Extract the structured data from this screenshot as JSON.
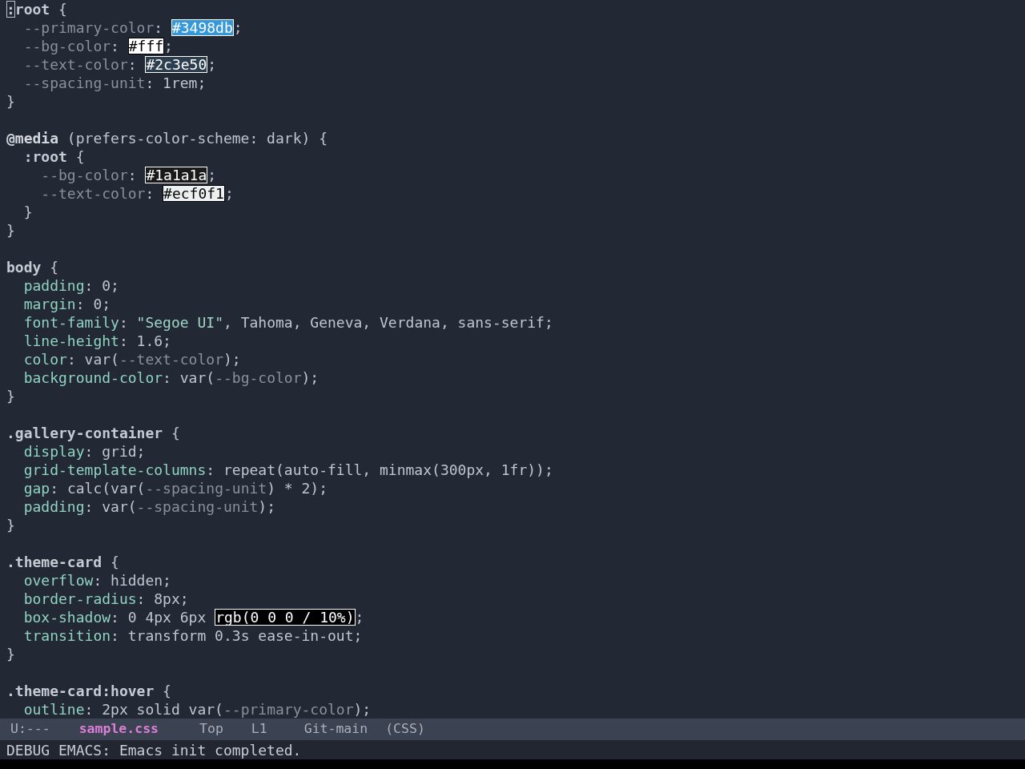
{
  "editor": {
    "lines": [
      {
        "kind": "code",
        "tokens": [
          {
            "kind": "cursor",
            "text": ":"
          },
          {
            "kind": "selector",
            "text": "root"
          },
          {
            "kind": "punct",
            "text": " {"
          }
        ]
      },
      {
        "kind": "code",
        "tokens": [
          {
            "kind": "variable",
            "text": "  --primary-color"
          },
          {
            "kind": "punct",
            "text": ": "
          },
          {
            "kind": "swatch",
            "text": "#3498db",
            "color": "#3498db"
          },
          {
            "kind": "punct",
            "text": ";"
          }
        ]
      },
      {
        "kind": "code",
        "tokens": [
          {
            "kind": "variable",
            "text": "  --bg-color"
          },
          {
            "kind": "punct",
            "text": ": "
          },
          {
            "kind": "swatch",
            "text": "#fff",
            "color": "#ffffff"
          },
          {
            "kind": "punct",
            "text": ";"
          }
        ]
      },
      {
        "kind": "code",
        "tokens": [
          {
            "kind": "variable",
            "text": "  --text-color"
          },
          {
            "kind": "punct",
            "text": ": "
          },
          {
            "kind": "swatch",
            "text": "#2c3e50",
            "color": "#2c3e50"
          },
          {
            "kind": "punct",
            "text": ";"
          }
        ]
      },
      {
        "kind": "code",
        "tokens": [
          {
            "kind": "variable",
            "text": "  --spacing-unit"
          },
          {
            "kind": "punct",
            "text": ": "
          },
          {
            "kind": "value",
            "text": "1rem;"
          }
        ]
      },
      {
        "kind": "code",
        "tokens": [
          {
            "kind": "punct",
            "text": "}"
          }
        ]
      },
      {
        "kind": "blank"
      },
      {
        "kind": "code",
        "tokens": [
          {
            "kind": "at_rule",
            "text": "@media"
          },
          {
            "kind": "value",
            "text": " (prefers-color-scheme: dark) {"
          }
        ]
      },
      {
        "kind": "code",
        "tokens": [
          {
            "kind": "selector",
            "text": "  :root"
          },
          {
            "kind": "punct",
            "text": " {"
          }
        ]
      },
      {
        "kind": "code",
        "tokens": [
          {
            "kind": "variable",
            "text": "    --bg-color"
          },
          {
            "kind": "punct",
            "text": ": "
          },
          {
            "kind": "swatch",
            "text": "#1a1a1a",
            "color": "#1a1a1a"
          },
          {
            "kind": "punct",
            "text": ";"
          }
        ]
      },
      {
        "kind": "code",
        "tokens": [
          {
            "kind": "variable",
            "text": "    --text-color"
          },
          {
            "kind": "punct",
            "text": ": "
          },
          {
            "kind": "swatch",
            "text": "#ecf0f1",
            "color": "#ecf0f1"
          },
          {
            "kind": "punct",
            "text": ";"
          }
        ]
      },
      {
        "kind": "code",
        "tokens": [
          {
            "kind": "punct",
            "text": "  }"
          }
        ]
      },
      {
        "kind": "code",
        "tokens": [
          {
            "kind": "punct",
            "text": "}"
          }
        ]
      },
      {
        "kind": "blank"
      },
      {
        "kind": "code",
        "tokens": [
          {
            "kind": "selector",
            "text": "body"
          },
          {
            "kind": "punct",
            "text": " {"
          }
        ]
      },
      {
        "kind": "code",
        "tokens": [
          {
            "kind": "property",
            "text": "  padding"
          },
          {
            "kind": "punct",
            "text": ": "
          },
          {
            "kind": "value",
            "text": "0;"
          }
        ]
      },
      {
        "kind": "code",
        "tokens": [
          {
            "kind": "property",
            "text": "  margin"
          },
          {
            "kind": "punct",
            "text": ": "
          },
          {
            "kind": "value",
            "text": "0;"
          }
        ]
      },
      {
        "kind": "code",
        "tokens": [
          {
            "kind": "property",
            "text": "  font-family"
          },
          {
            "kind": "punct",
            "text": ": "
          },
          {
            "kind": "string",
            "text": "\"Segoe UI\""
          },
          {
            "kind": "value",
            "text": ", Tahoma, Geneva, Verdana, sans-serif;"
          }
        ]
      },
      {
        "kind": "code",
        "tokens": [
          {
            "kind": "property",
            "text": "  line-height"
          },
          {
            "kind": "punct",
            "text": ": "
          },
          {
            "kind": "value",
            "text": "1.6;"
          }
        ]
      },
      {
        "kind": "code",
        "tokens": [
          {
            "kind": "property",
            "text": "  color"
          },
          {
            "kind": "punct",
            "text": ": "
          },
          {
            "kind": "value",
            "text": "var("
          },
          {
            "kind": "variable",
            "text": "--text-color"
          },
          {
            "kind": "value",
            "text": ");"
          }
        ]
      },
      {
        "kind": "code",
        "tokens": [
          {
            "kind": "property",
            "text": "  background-color"
          },
          {
            "kind": "punct",
            "text": ": "
          },
          {
            "kind": "value",
            "text": "var("
          },
          {
            "kind": "variable",
            "text": "--bg-color"
          },
          {
            "kind": "value",
            "text": ");"
          }
        ]
      },
      {
        "kind": "code",
        "tokens": [
          {
            "kind": "punct",
            "text": "}"
          }
        ]
      },
      {
        "kind": "blank"
      },
      {
        "kind": "code",
        "tokens": [
          {
            "kind": "selector",
            "text": ".gallery-container"
          },
          {
            "kind": "punct",
            "text": " {"
          }
        ]
      },
      {
        "kind": "code",
        "tokens": [
          {
            "kind": "property",
            "text": "  display"
          },
          {
            "kind": "punct",
            "text": ": "
          },
          {
            "kind": "value",
            "text": "grid;"
          }
        ]
      },
      {
        "kind": "code",
        "tokens": [
          {
            "kind": "property",
            "text": "  grid-template-columns"
          },
          {
            "kind": "punct",
            "text": ": "
          },
          {
            "kind": "value",
            "text": "repeat(auto-fill, minmax(300px, 1fr));"
          }
        ]
      },
      {
        "kind": "code",
        "tokens": [
          {
            "kind": "property",
            "text": "  gap"
          },
          {
            "kind": "punct",
            "text": ": "
          },
          {
            "kind": "value",
            "text": "calc(var("
          },
          {
            "kind": "variable",
            "text": "--spacing-unit"
          },
          {
            "kind": "value",
            "text": ") * 2);"
          }
        ]
      },
      {
        "kind": "code",
        "tokens": [
          {
            "kind": "property",
            "text": "  padding"
          },
          {
            "kind": "punct",
            "text": ": "
          },
          {
            "kind": "value",
            "text": "var("
          },
          {
            "kind": "variable",
            "text": "--spacing-unit"
          },
          {
            "kind": "value",
            "text": ");"
          }
        ]
      },
      {
        "kind": "code",
        "tokens": [
          {
            "kind": "punct",
            "text": "}"
          }
        ]
      },
      {
        "kind": "blank"
      },
      {
        "kind": "code",
        "tokens": [
          {
            "kind": "selector",
            "text": ".theme-card"
          },
          {
            "kind": "punct",
            "text": " {"
          }
        ]
      },
      {
        "kind": "code",
        "tokens": [
          {
            "kind": "property",
            "text": "  overflow"
          },
          {
            "kind": "punct",
            "text": ": "
          },
          {
            "kind": "value",
            "text": "hidden;"
          }
        ]
      },
      {
        "kind": "code",
        "tokens": [
          {
            "kind": "property",
            "text": "  border-radius"
          },
          {
            "kind": "punct",
            "text": ": "
          },
          {
            "kind": "value",
            "text": "8px;"
          }
        ]
      },
      {
        "kind": "code",
        "tokens": [
          {
            "kind": "property",
            "text": "  box-shadow"
          },
          {
            "kind": "punct",
            "text": ": "
          },
          {
            "kind": "value",
            "text": "0 4px 6px "
          },
          {
            "kind": "swatch",
            "text": "rgb(0 0 0 / 10%)",
            "color": "#000000"
          },
          {
            "kind": "punct",
            "text": ";"
          }
        ]
      },
      {
        "kind": "code",
        "tokens": [
          {
            "kind": "property",
            "text": "  transition"
          },
          {
            "kind": "punct",
            "text": ": "
          },
          {
            "kind": "value",
            "text": "transform 0.3s ease-in-out;"
          }
        ]
      },
      {
        "kind": "code",
        "tokens": [
          {
            "kind": "punct",
            "text": "}"
          }
        ]
      },
      {
        "kind": "blank"
      },
      {
        "kind": "code",
        "tokens": [
          {
            "kind": "selector",
            "text": ".theme-card:hover"
          },
          {
            "kind": "punct",
            "text": " {"
          }
        ]
      },
      {
        "kind": "code",
        "tokens": [
          {
            "kind": "property",
            "text": "  outline"
          },
          {
            "kind": "punct",
            "text": ": "
          },
          {
            "kind": "value",
            "text": "2px solid var("
          },
          {
            "kind": "variable",
            "text": "--primary-color"
          },
          {
            "kind": "value",
            "text": ");"
          }
        ]
      }
    ]
  },
  "mode_line": {
    "segments": [
      {
        "kind": "status",
        "text": "U:---"
      },
      {
        "kind": "buffer",
        "text": "sample.css"
      },
      {
        "kind": "position",
        "text": "Top"
      },
      {
        "kind": "line",
        "text": "L1"
      },
      {
        "kind": "vc",
        "text": "Git-main"
      },
      {
        "kind": "mode",
        "text": "(CSS)"
      }
    ]
  },
  "echo_area": {
    "message": "DEBUG EMACS: Emacs init completed."
  }
}
